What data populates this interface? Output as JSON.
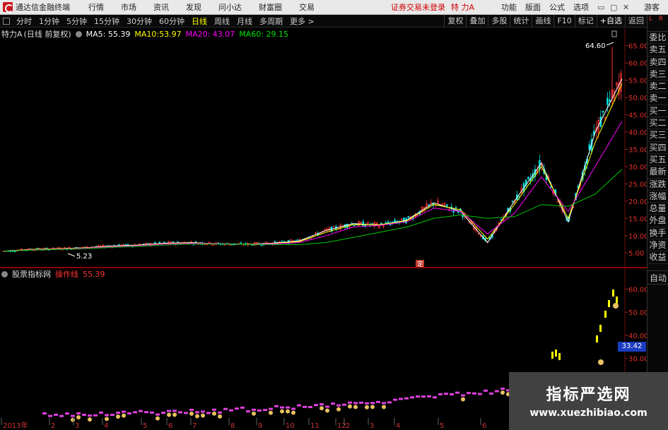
{
  "app": {
    "title": "通达信金融终端"
  },
  "menu": [
    "行情",
    "市场",
    "资讯",
    "发现",
    "问小达",
    "财富圈",
    "交易"
  ],
  "status": {
    "warning": "证券交易未登录",
    "stock_name": "特 力A"
  },
  "top_right": [
    "功能",
    "版面",
    "公式",
    "选项"
  ],
  "window_controls": {
    "guest": "游客"
  },
  "periods": [
    "分时",
    "1分钟",
    "5分钟",
    "15分钟",
    "30分钟",
    "60分钟",
    "日线",
    "周线",
    "月线",
    "多周期",
    "更多 >"
  ],
  "active_period": "日线",
  "tools": [
    "复权",
    "叠加",
    "多股",
    "统计",
    "画线",
    "F10",
    "标记",
    "+自选",
    "返回"
  ],
  "side_panel": {
    "header_l": "L",
    "header_r": "R",
    "items": [
      "委比",
      "卖五",
      "卖四",
      "卖三",
      "卖二",
      "卖一",
      "买一",
      "买二",
      "买三",
      "买四",
      "买五",
      "最新",
      "涨跌",
      "涨幅",
      "总量",
      "外盘",
      "换手",
      "净资",
      "收益"
    ],
    "auto": "自动"
  },
  "main_info": {
    "name": "特力A",
    "mode": "(日线 前复权)",
    "ma5_label": "MA5:",
    "ma5": "55.39",
    "ma10_label": "MA10:",
    "ma10": "53.97",
    "ma20_label": "MA20:",
    "ma20": "43.07",
    "ma60_label": "MA60:",
    "ma60": "29.15",
    "high_label": "64.60",
    "low_label": "5.23",
    "marker": "定"
  },
  "sub_info": {
    "name": "股票指标网",
    "indicator": "操作线",
    "value": "55.39",
    "box_value": "33.42"
  },
  "colors": {
    "ma5": "#ffffff",
    "ma10": "#ffff00",
    "ma20": "#ff00ff",
    "ma60": "#00cc00",
    "axis": "#e0302a",
    "up": "#ff3333",
    "down": "#00e0e0"
  },
  "chart_data": {
    "type": "line",
    "y_axis_main": [
      65.0,
      60.0,
      55.0,
      50.0,
      45.0,
      40.0,
      35.0,
      30.0,
      25.0,
      20.0,
      15.0,
      10.0,
      5.0
    ],
    "y_axis_sub": [
      60.0,
      50.0,
      40.0,
      30.0
    ],
    "x_labels": [
      "2013年",
      "2",
      "3",
      "4",
      "5",
      "6",
      "7",
      "8",
      "9",
      "10",
      "11",
      "12",
      "2",
      "3",
      "4",
      "5",
      "6"
    ],
    "series": [
      {
        "name": "MA5",
        "values": [
          5.5,
          6.0,
          6.2,
          6.5,
          7.0,
          7.3,
          7.8,
          8.0,
          7.6,
          7.5,
          7.8,
          8.5,
          11.5,
          13.5,
          13.0,
          14.5,
          19.5,
          17.0,
          8.0,
          20.0,
          31.0,
          14.0,
          40.0,
          55.4
        ]
      },
      {
        "name": "MA10",
        "values": [
          5.5,
          6.0,
          6.2,
          6.5,
          6.9,
          7.2,
          7.7,
          7.9,
          7.7,
          7.5,
          7.7,
          8.3,
          11.0,
          13.2,
          13.2,
          14.3,
          19.0,
          17.5,
          9.0,
          19.0,
          30.0,
          15.0,
          37.0,
          54.0
        ]
      },
      {
        "name": "MA20",
        "values": [
          5.5,
          5.9,
          6.1,
          6.4,
          6.8,
          7.1,
          7.6,
          7.8,
          7.7,
          7.5,
          7.6,
          8.0,
          10.0,
          12.5,
          13.0,
          14.0,
          18.0,
          17.0,
          10.5,
          16.5,
          27.0,
          17.0,
          30.0,
          43.1
        ]
      },
      {
        "name": "MA60",
        "values": [
          5.5,
          5.8,
          6.0,
          6.2,
          6.6,
          6.9,
          7.3,
          7.6,
          7.6,
          7.5,
          7.4,
          7.4,
          8.0,
          9.5,
          11.0,
          12.5,
          15.0,
          16.0,
          15.0,
          15.5,
          19.0,
          18.5,
          22.0,
          29.2
        ]
      }
    ],
    "ylim": [
      3,
      68
    ]
  }
}
